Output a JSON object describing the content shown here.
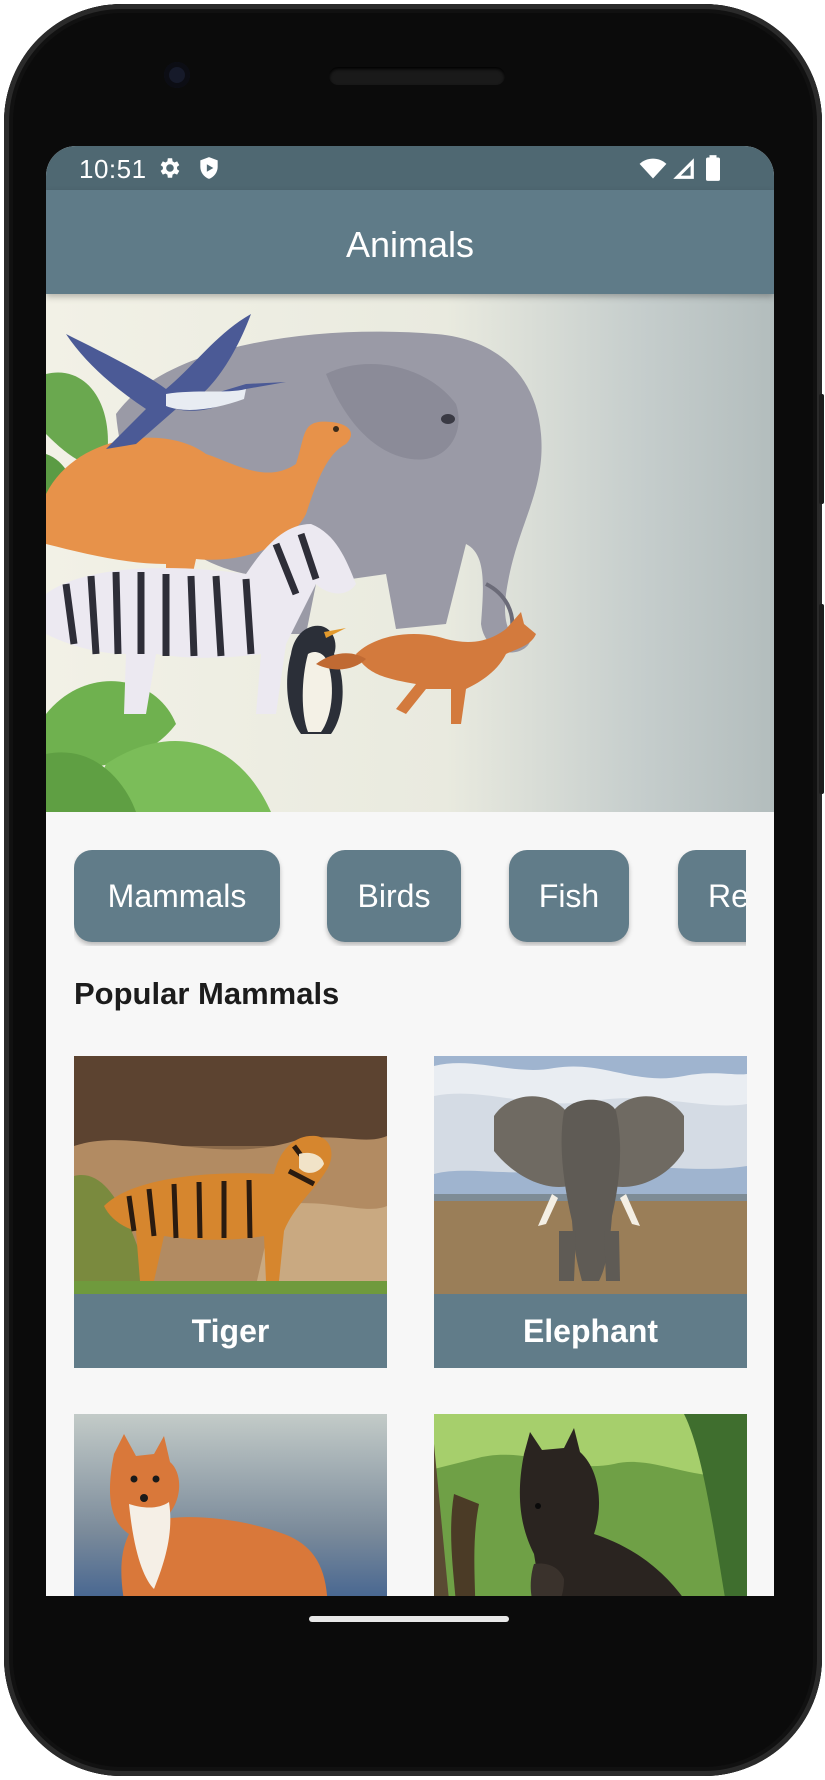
{
  "status_bar": {
    "time": "10:51",
    "left_icons": [
      "gear-icon",
      "shield-icon"
    ],
    "right_icons": [
      "wifi-icon",
      "cell-signal-icon",
      "battery-icon"
    ]
  },
  "app_bar": {
    "title": "Animals"
  },
  "hero": {
    "image": "watercolor-animals-illustration"
  },
  "categories": [
    {
      "label": "Mammals"
    },
    {
      "label": "Birds"
    },
    {
      "label": "Fish"
    },
    {
      "label": "Re"
    }
  ],
  "section": {
    "title": "Popular Mammals"
  },
  "cards": [
    {
      "name": "Tiger",
      "image": "tiger-photo"
    },
    {
      "name": "Elephant",
      "image": "elephant-photo"
    },
    {
      "name": "",
      "image": "fox-photo"
    },
    {
      "name": "",
      "image": "horse-photo"
    }
  ],
  "colors": {
    "status_bar": "#4f6872",
    "app_bar": "#5f7b88",
    "chip": "#617c89",
    "card_label": "#617c89",
    "background": "#f7f7f7"
  }
}
